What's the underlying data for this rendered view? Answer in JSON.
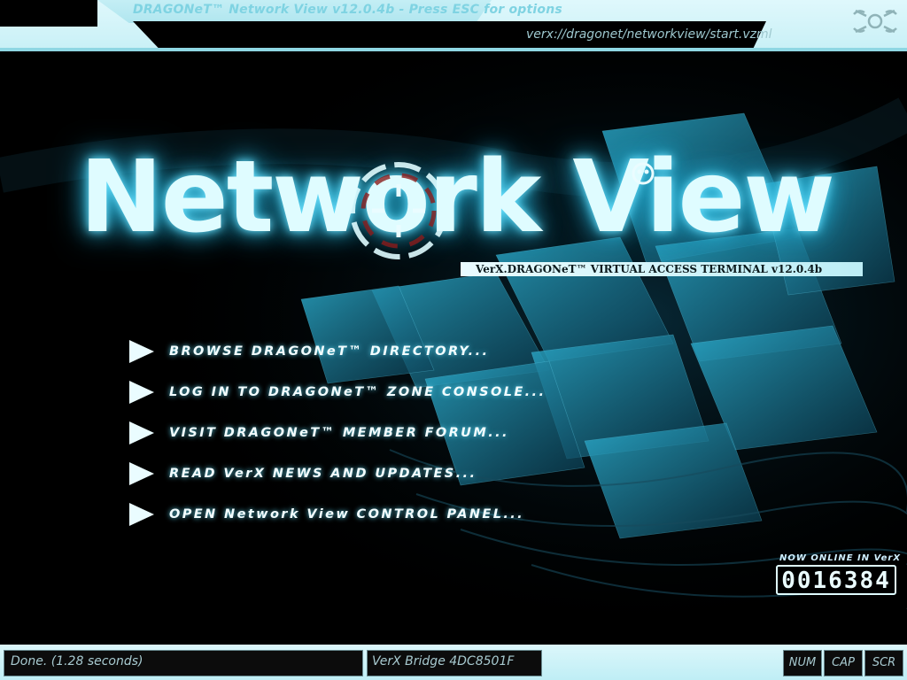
{
  "window": {
    "title": "DRAGONeT™ Network View v12.0.4b - Press ESC for options",
    "url": "verx://dragonet/networkview/start.vzml"
  },
  "logo": {
    "text": "Network View",
    "subtitle": "VerX.DRAGONeT™ VIRTUAL ACCESS TERMINAL v12.0.4b"
  },
  "menu": {
    "items": [
      {
        "label": "BROWSE DRAGONeT™ DIRECTORY..."
      },
      {
        "label": "LOG IN TO DRAGONeT™ ZONE CONSOLE..."
      },
      {
        "label": "VISIT DRAGONeT™ MEMBER FORUM..."
      },
      {
        "label": "READ VerX NEWS AND UPDATES..."
      },
      {
        "label": "OPEN Network View CONTROL PANEL..."
      }
    ]
  },
  "online": {
    "label": "NOW ONLINE IN VerX",
    "count": "0016384"
  },
  "status": {
    "message": "Done. (1.28 seconds)",
    "bridge": "VerX Bridge 4DC8501F",
    "indicators": [
      "NUM",
      "CAP",
      "SCR"
    ]
  },
  "colors": {
    "accent": "#6fe3ff",
    "chrome": "#c8f0f6",
    "background": "#000000"
  }
}
